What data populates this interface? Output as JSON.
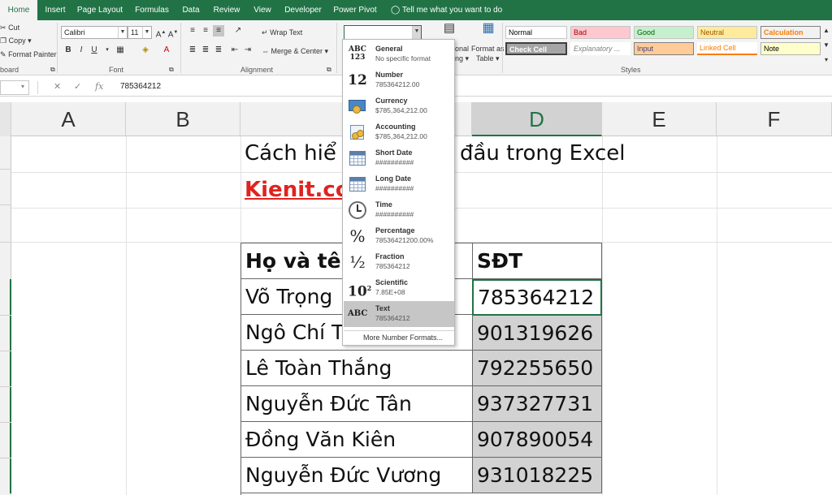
{
  "ribbon": {
    "tabs": [
      "Home",
      "Insert",
      "Page Layout",
      "Formulas",
      "Data",
      "Review",
      "View",
      "Developer",
      "Power Pivot"
    ],
    "tell_me": "Tell me what you want to do",
    "clipboard": {
      "cut": "Cut",
      "copy": "Copy",
      "format_painter": "Format Painter",
      "group": "board"
    },
    "font": {
      "name": "Calibri",
      "size": "11",
      "group": "Font"
    },
    "alignment": {
      "wrap_text": "Wrap Text",
      "merge_center": "Merge & Center",
      "group": "Alignment"
    },
    "number": {
      "format_value": ""
    },
    "cond_format": {
      "line1": "onal",
      "line2": "ng"
    },
    "format_table": {
      "line1": "Format as",
      "line2": "Table"
    },
    "styles": {
      "group": "Styles",
      "cells": [
        {
          "label": "Normal",
          "bg": "#ffffff",
          "fg": "#000000"
        },
        {
          "label": "Bad",
          "bg": "#ffc7ce",
          "fg": "#9c0006"
        },
        {
          "label": "Good",
          "bg": "#c6efce",
          "fg": "#006100"
        },
        {
          "label": "Neutral",
          "bg": "#ffeb9c",
          "fg": "#9c5700"
        },
        {
          "label": "Calculation",
          "bg": "#f2f2f2",
          "fg": "#fa7d00"
        },
        {
          "label": "Check Cell",
          "bg": "#a5a5a5",
          "fg": "#ffffff"
        },
        {
          "label": "Explanatory ...",
          "bg": "#ffffff",
          "fg": "#7f7f7f"
        },
        {
          "label": "Input",
          "bg": "#ffcc99",
          "fg": "#3f3f76"
        },
        {
          "label": "Linked Cell",
          "bg": "#ffffff",
          "fg": "#fa7d00"
        },
        {
          "label": "Note",
          "bg": "#ffffcc",
          "fg": "#000000"
        }
      ]
    }
  },
  "formula_bar": {
    "value": "785364212",
    "fx": "fx"
  },
  "columns": [
    "A",
    "B",
    "C",
    "D",
    "E",
    "F"
  ],
  "sheet": {
    "title_visible_left": "Cách hiể",
    "title_visible_right": "đầu trong Excel",
    "link_visible": "Kienit.co",
    "table": {
      "header": {
        "name": "Họ và tên",
        "phone": "SĐT"
      },
      "rows": [
        {
          "name": "Võ Trọng",
          "phone": "785364212"
        },
        {
          "name": "Ngô Chí T",
          "phone": "901319626"
        },
        {
          "name": "Lê Toàn Thắng",
          "phone": "792255650"
        },
        {
          "name": "Nguyễn Đức Tân",
          "phone": "937327731"
        },
        {
          "name": "Đồng Văn Kiên",
          "phone": "907890054"
        },
        {
          "name": "Nguyễn Đức Vương",
          "phone": "931018225"
        }
      ]
    }
  },
  "number_format_menu": {
    "items": [
      {
        "icon": "ABC 123",
        "title": "General",
        "sample": "No specific format"
      },
      {
        "icon": "12",
        "title": "Number",
        "sample": "785364212.00"
      },
      {
        "icon": "currency-icon",
        "title": "Currency",
        "sample": "$785,364,212.00"
      },
      {
        "icon": "accounting-icon",
        "title": "Accounting",
        "sample": " $785,364,212.00"
      },
      {
        "icon": "calendar-icon",
        "title": "Short Date",
        "sample": "##########"
      },
      {
        "icon": "calendar-icon",
        "title": "Long Date",
        "sample": "##########"
      },
      {
        "icon": "clock-icon",
        "title": "Time",
        "sample": "##########"
      },
      {
        "icon": "%",
        "title": "Percentage",
        "sample": "78536421200.00%"
      },
      {
        "icon": "½",
        "title": "Fraction",
        "sample": "785364212"
      },
      {
        "icon": "10²",
        "title": "Scientific",
        "sample": "7.85E+08"
      },
      {
        "icon": "ABC",
        "title": "Text",
        "sample": "785364212"
      }
    ],
    "more": "More Number Formats..."
  }
}
